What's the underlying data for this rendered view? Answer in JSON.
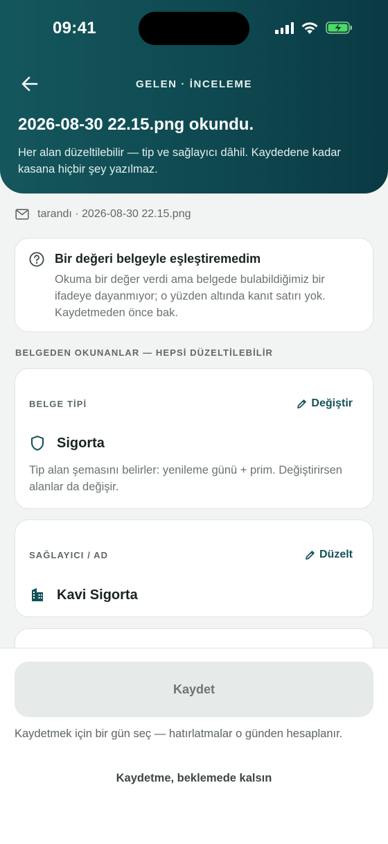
{
  "status_bar": {
    "time": "09:41"
  },
  "header": {
    "nav_title": "GELEN · İNCELEME",
    "title": "2026-08-30 22.15.png okundu.",
    "subtitle": "Her alan düzeltilebilir — tip ve sağlayıcı dâhil. Kaydedene kadar kasana hiçbir şey yazılmaz."
  },
  "scan_info": "tarandı · 2026-08-30 22.15.png",
  "warning": {
    "title": "Bir değeri belgeyle eşleştiremedim",
    "body": "Okuma bir değer verdi ama belgede bulabildiğimiz bir ifadeye dayanmıyor; o yüzden altında kanıt satırı yok. Kaydetmeden önce bak."
  },
  "section_label": "BELGEDEN OKUNANLAR — HEPSİ DÜZELTİLEBİLİR",
  "document_type": {
    "label": "BELGE TİPİ",
    "action": "Değiştir",
    "value": "Sigorta",
    "description": "Tip alan şemasını belirler: yenileme günü + prim. Değiştirirsen alanlar da değişir."
  },
  "provider": {
    "label": "SAĞLAYICI / AD",
    "action": "Düzelt",
    "value": "Kavi Sigorta"
  },
  "footer": {
    "save_label": "Kaydet",
    "hint": "Kaydetmek için bir gün seç — hatırlatmalar o günden hesaplanır.",
    "later_label": "Kaydetme, beklemede kalsın"
  },
  "colors": {
    "brand": "#0f4a52",
    "accent": "#14525a",
    "battery": "#4cd964"
  }
}
